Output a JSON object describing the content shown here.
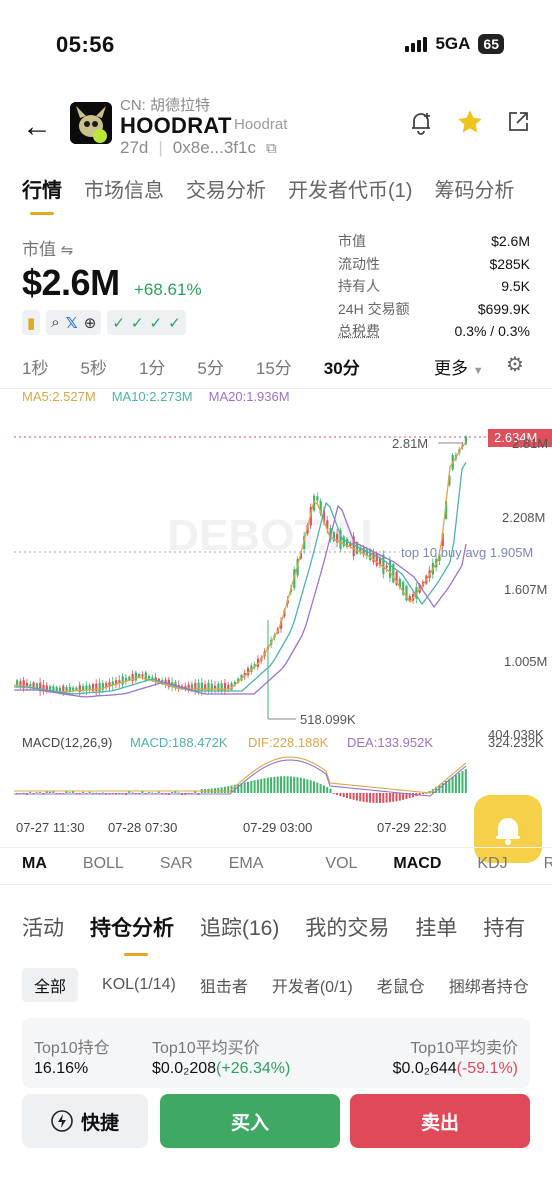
{
  "status_bar": {
    "time": "05:56",
    "network": "5GA",
    "battery": "65"
  },
  "token": {
    "cn_name": "CN: 胡德拉特",
    "symbol": "HOODRAT",
    "name": "Hoodrat",
    "age": "27d",
    "address": "0x8e...3f1c"
  },
  "main_tabs": [
    "行情",
    "市场信息",
    "交易分析",
    "开发者代币(1)",
    "筹码分析"
  ],
  "market_cap": {
    "label": "市值",
    "value": "$2.6M",
    "change": "+68.61%"
  },
  "stats": [
    {
      "label": "市值",
      "value": "$2.6M"
    },
    {
      "label": "流动性",
      "value": "$285K"
    },
    {
      "label": "持有人",
      "value": "9.5K"
    },
    {
      "label": "24H 交易额",
      "value": "$699.9K"
    },
    {
      "label": "总税费",
      "value": "0.3% / 0.3%"
    }
  ],
  "timeframes": [
    "1秒",
    "5秒",
    "1分",
    "5分",
    "15分",
    "30分"
  ],
  "timeframe_active": "30分",
  "timeframe_more": "更多",
  "ma_legend": {
    "ma5": "MA5:2.527M",
    "ma10": "MA10:2.273M",
    "ma20": "MA20:1.936M",
    "colors": {
      "ma5": "#d8a94a",
      "ma10": "#4fb3a5",
      "ma20": "#9b74c8"
    }
  },
  "chart": {
    "watermark": "DEBOT.AI",
    "price_axis": [
      "2.81M",
      "2.208M",
      "1.607M",
      "1.005M",
      "404.038K"
    ],
    "current_price": "2.634M",
    "high_label": "2.81M",
    "low_label": "518.099K",
    "avg_buy_label": "top 10 buy avg 1.905M",
    "macd_label": "MACD(12,26,9)",
    "macd_value": "MACD:188.472K",
    "dif_value": "DIF:228.188K",
    "dea_value": "DEA:133.952K",
    "macd_axis_top": "324.232K",
    "time_axis": [
      "07-27 11:30",
      "07-28 07:30",
      "07-29 03:00",
      "07-29 22:30"
    ],
    "colors": {
      "up": "#3fb46a",
      "down": "#e0505c",
      "current": "#e0505c"
    }
  },
  "indicator_tabs": [
    "MA",
    "BOLL",
    "SAR",
    "EMA",
    "VOL",
    "MACD",
    "KDJ",
    "RSI"
  ],
  "indicator_active": [
    "MA",
    "MACD"
  ],
  "section_tabs": [
    "活动",
    "持仓分析",
    "追踪(16)",
    "我的交易",
    "挂单",
    "持有"
  ],
  "section_active": "持仓分析",
  "filter_tabs": [
    "全部",
    "KOL(1/14)",
    "狙击者",
    "开发者(0/1)",
    "老鼠仓",
    "捆绑者持仓"
  ],
  "summary": {
    "top10_hold_label": "Top10持仓",
    "top10_hold_value": "16.16%",
    "avg_buy_label": "Top10平均买价",
    "avg_buy_value": "$0.0₂208",
    "avg_buy_change": "(+26.34%)",
    "avg_sell_label": "Top10平均卖价",
    "avg_sell_value": "$0.0₂644",
    "avg_sell_change": "(-59.1%)"
  },
  "actions": {
    "quick": "快捷",
    "buy": "买入",
    "sell": "卖出"
  }
}
